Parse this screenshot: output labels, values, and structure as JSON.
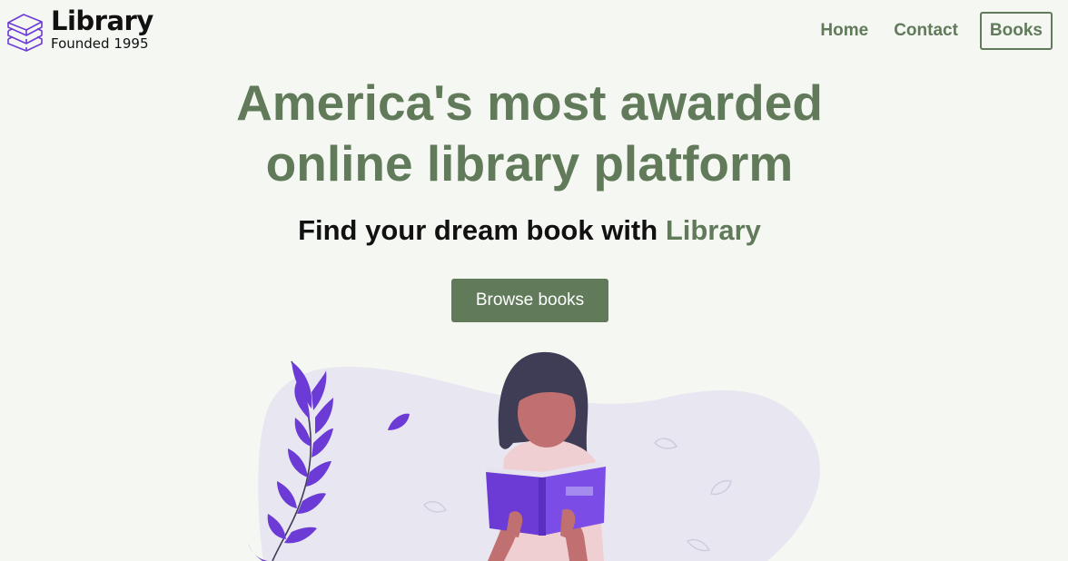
{
  "header": {
    "logo_title": "Library",
    "logo_subtitle": "Founded 1995",
    "logo_icon": "books-stack-icon",
    "nav": [
      {
        "label": "Home"
      },
      {
        "label": "Contact"
      },
      {
        "label": "Books"
      }
    ]
  },
  "hero": {
    "title_line1": "America's most awarded",
    "title_line2": "online library platform",
    "subtitle_prefix": "Find your dream book with ",
    "subtitle_accent": "Library",
    "cta_label": "Browse books"
  },
  "illustration": {
    "name": "woman-reading-book-illustration"
  },
  "colors": {
    "background": "#f5f7f2",
    "accent_green": "#607a5a",
    "blob": "#e8e6f1",
    "purple": "#6c3bd6",
    "text_dark": "#111111"
  }
}
